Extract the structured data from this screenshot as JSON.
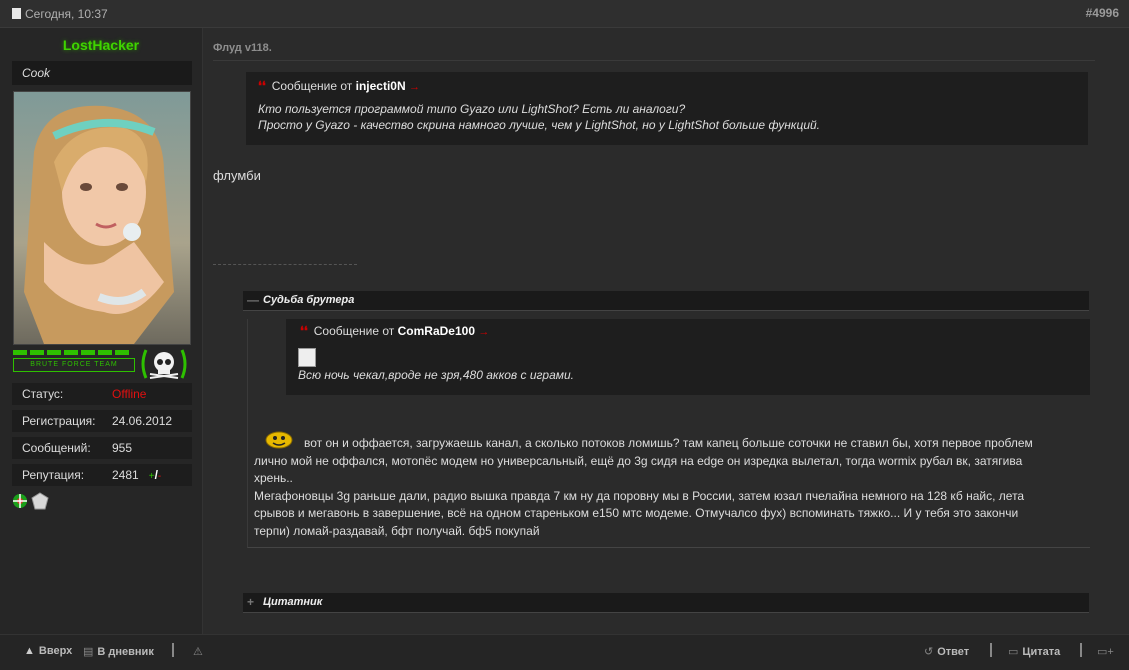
{
  "header": {
    "date": "Сегодня, 10:37",
    "post_number": "#4996"
  },
  "user": {
    "name": "LostHacker",
    "title": "Cook",
    "team_label": "BRUTE FORCE TEAM",
    "stats": [
      {
        "key": "Статус:",
        "value": "Offline"
      },
      {
        "key": "Регистрация:",
        "value": "24.06.2012"
      },
      {
        "key": "Сообщений:",
        "value": "955"
      },
      {
        "key": "Репутация:",
        "value": "2481"
      }
    ],
    "rep_plus": "+",
    "rep_slash": "/",
    "rep_minus": "-"
  },
  "post": {
    "title": "Флуд v118.",
    "quote1": {
      "prefix": "Сообщение от",
      "author": "injecti0N",
      "line1": "Кто пользуется программой типо Gyazo или LightShot? Есть ли аналоги?",
      "line2": "Просто у Gyazo - качество скрина намного лучше, чем у LightShot, но у LightShot больше функций."
    },
    "reply": "флумби",
    "spoiler1": {
      "label": "Судьба брутера",
      "toggle": "—",
      "quote": {
        "prefix": "Сообщение от",
        "author": "ComRaDe100",
        "text": "Всю ночь чекал,вроде не зря,480 акков с играми."
      },
      "lines": [
        "вот он и оффается, загружаешь канал, а сколько потоков ломишь? там капец больше соточки не ставил бы, хотя первое проблем",
        "лично мой не оффался, мотопёс модем но универсальный, ещё до 3g сидя на edge он изредка вылетал, тогда wormix рубал вк, затягива",
        "хрень..",
        "Мегафоновцы 3g раньше дали, радио вышка правда 7 км ну да поровну мы в России, затем юзал пчелайна немного на 128 кб найс, лета",
        "срывов и мегавонь в завершение, всё на одном стареньком е150 мтс модеме. Отмучалсо фух) вспоминать тяжко... И у тебя это закончи",
        "терпи) ломай-раздавай, бфт получай. бф5 покупай"
      ]
    },
    "spoiler2": {
      "label": "Цитатник",
      "toggle": "+"
    }
  },
  "footer": {
    "up": "Вверх",
    "diary": "В дневник",
    "reply": "Ответ",
    "quote": "Цитата"
  },
  "colors": {
    "accent_green": "#3fd400",
    "offline_red": "#e01010",
    "quote_red": "#cc0000"
  },
  "icons": [
    "doc-icon",
    "skull-icon",
    "flower-icon",
    "gem-icon",
    "smiley-icon",
    "arrow-up-icon",
    "diary-icon",
    "warning-icon",
    "reply-icon",
    "quote-icon",
    "multiquote-icon",
    "broken-image-icon"
  ]
}
